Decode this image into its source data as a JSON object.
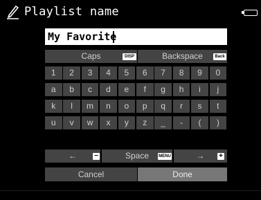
{
  "header": {
    "title": "Playlist name"
  },
  "input": {
    "value": "My Favorite"
  },
  "keyboard": {
    "caps_label": "Caps",
    "caps_tag": "DISP",
    "backspace_label": "Backspace",
    "backspace_tag": "Back",
    "rows": [
      [
        "1",
        "2",
        "3",
        "4",
        "5",
        "6",
        "7",
        "8",
        "9",
        "0"
      ],
      [
        "a",
        "b",
        "c",
        "d",
        "e",
        "f",
        "g",
        "h",
        "i",
        "j"
      ],
      [
        "k",
        "l",
        "m",
        "n",
        "o",
        "p",
        "q",
        "r",
        "s",
        "t"
      ],
      [
        "u",
        "v",
        "w",
        "x",
        "y",
        "z",
        "_",
        "-",
        "(",
        ")"
      ]
    ],
    "left_label": "←",
    "left_tag": "−",
    "space_label": "Space",
    "space_tag": "MENU",
    "right_label": "→",
    "right_tag": "+",
    "cancel_label": "Cancel",
    "done_label": "Done"
  }
}
